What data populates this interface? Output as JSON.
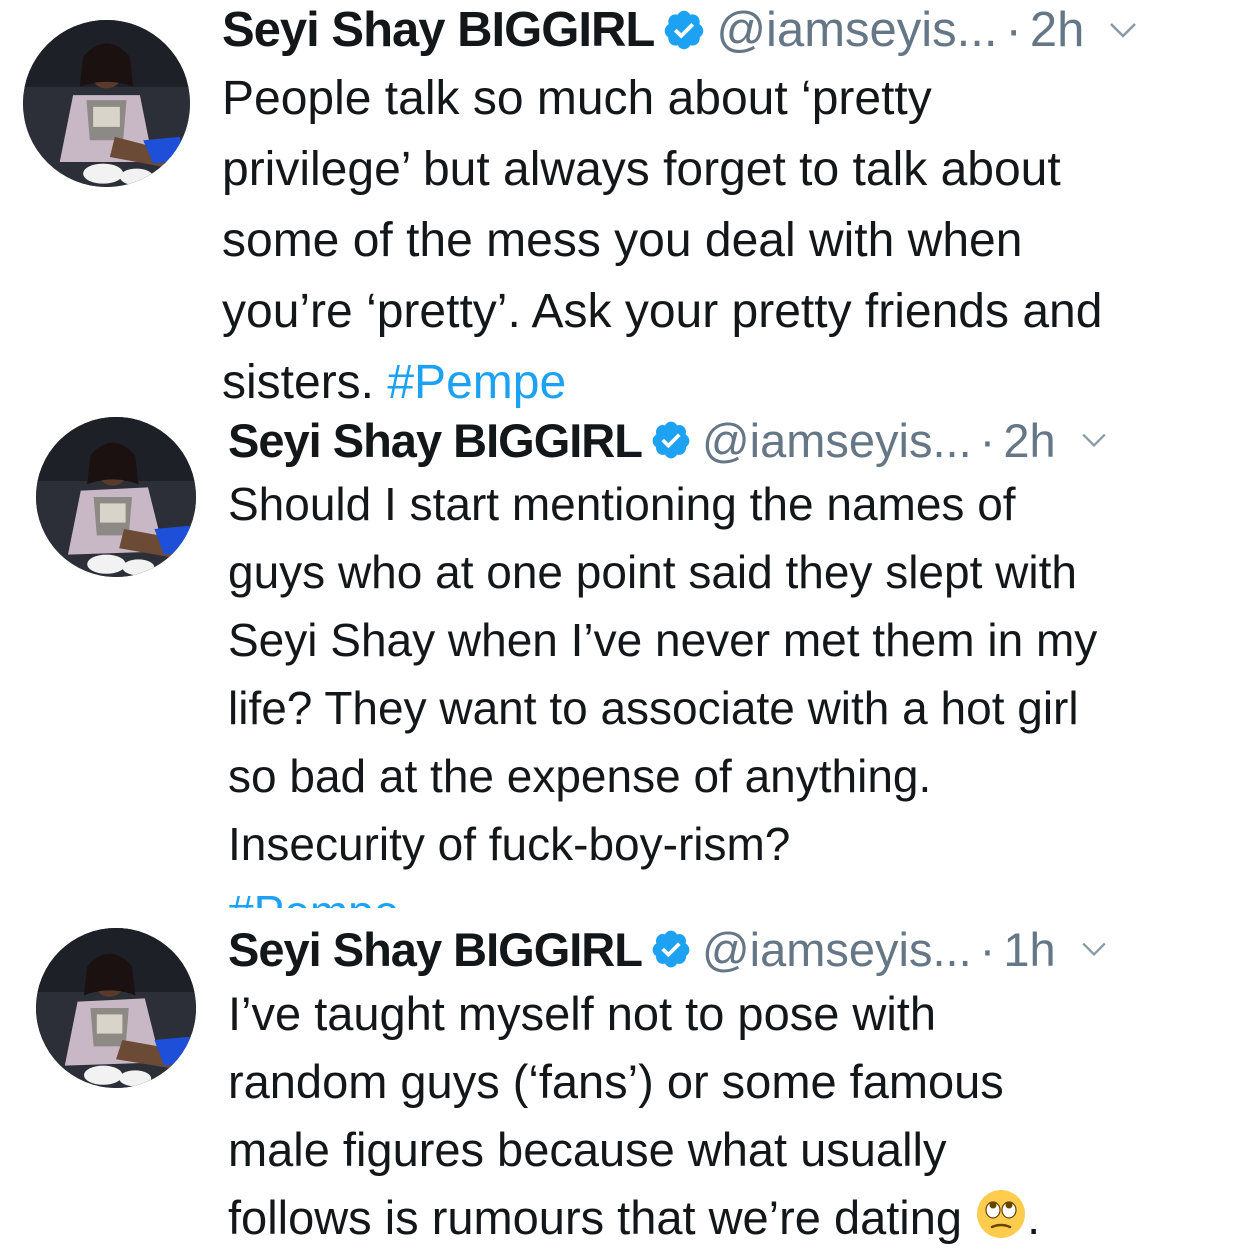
{
  "colors": {
    "text": "#14171a",
    "secondary": "#657786",
    "link": "#1da1f2",
    "verified": "#1da1f2"
  },
  "tweets": [
    {
      "name": "Seyi Shay BIGGIRL",
      "handle": "@iamseyis...",
      "dot": "·",
      "time": "2h",
      "text": "People talk so much about ‘pretty\nprivilege’ but always forget to talk about\nsome of the mess you deal with when\nyou’re ‘pretty’. Ask your pretty friends and\nsisters. ",
      "hashtag": "#Pempe",
      "icons": [
        "avatar",
        "verified-badge-icon",
        "chevron-down-icon"
      ]
    },
    {
      "name": "Seyi Shay BIGGIRL",
      "handle": "@iamseyis...",
      "dot": "·",
      "time": "2h",
      "text": "Should I start mentioning the names of\nguys who at one point said they slept with\nSeyi Shay when I’ve never met them in my\nlife? They want to associate with a hot girl\nso bad at the expense of anything.\nInsecurity of fuck-boy-rism?",
      "hashtag": "#Pempe",
      "icons": [
        "avatar",
        "verified-badge-icon",
        "chevron-down-icon"
      ]
    },
    {
      "name": "Seyi Shay BIGGIRL",
      "handle": "@iamseyis...",
      "dot": "·",
      "time": "1h",
      "text": "I’ve taught myself not to pose with\nrandom guys (‘fans’) or some famous\nmale figures because what usually\nfollows is rumours that we’re dating ",
      "text_end": ".",
      "emoji": "face-with-rolling-eyes-icon",
      "icons": [
        "avatar",
        "verified-badge-icon",
        "chevron-down-icon"
      ]
    }
  ]
}
